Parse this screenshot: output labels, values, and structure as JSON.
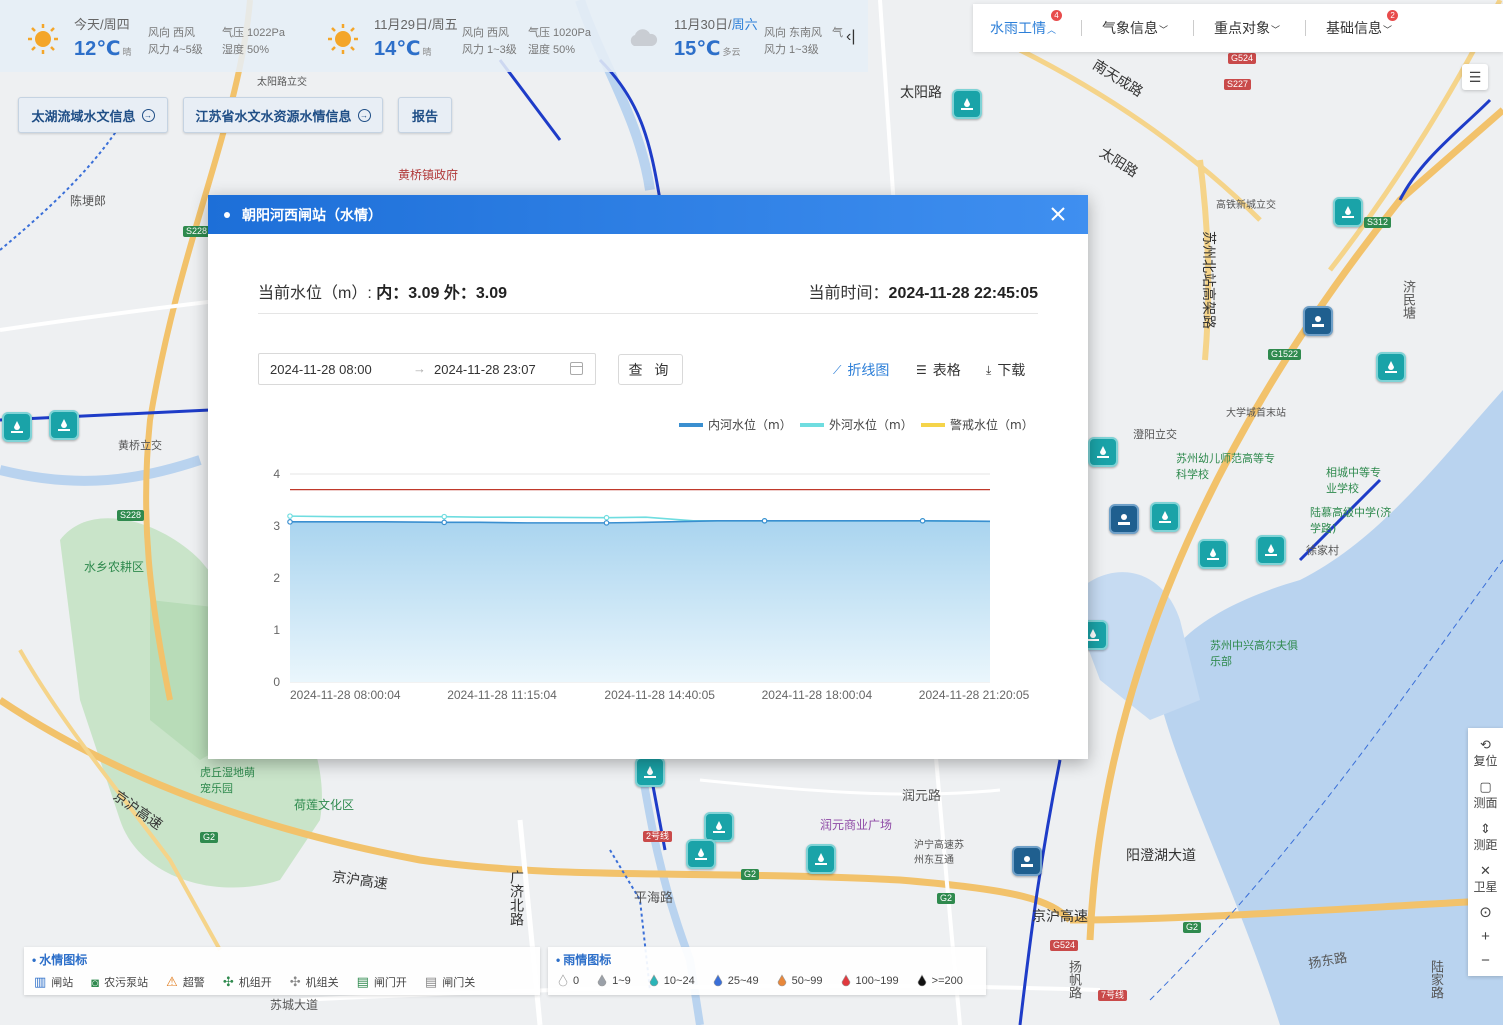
{
  "weather": [
    {
      "day": "今天/周四",
      "weekend": "",
      "temp": "12℃",
      "cond": "晴",
      "wind_dir": "风向 西风",
      "wind_force": "风力 4~5级",
      "pressure": "气压 1022Pa",
      "humidity": "湿度 50%",
      "icon": "sun-icon"
    },
    {
      "day": "11月29日/周五",
      "weekend": "",
      "temp": "14℃",
      "cond": "晴",
      "wind_dir": "风向 西风",
      "wind_force": "风力 1~3级",
      "pressure": "气压 1020Pa",
      "humidity": "湿度 50%",
      "icon": "sun-icon"
    },
    {
      "day": "11月30日/",
      "weekend": "周六",
      "temp": "15℃",
      "cond": "多云",
      "wind_dir": "风向 东南风",
      "wind_force": "风力 1~3级",
      "pressure": "气",
      "humidity": "",
      "icon": "cloud-icon"
    }
  ],
  "collapse_glyph": "‹|",
  "nav": [
    {
      "label": "水雨工情",
      "badge": "4",
      "active": true
    },
    {
      "label": "气象信息",
      "badge": "",
      "active": false
    },
    {
      "label": "重点对象",
      "badge": "",
      "active": false
    },
    {
      "label": "基础信息",
      "badge": "2",
      "active": false
    }
  ],
  "info_buttons": [
    {
      "label": "太湖流域水文信息",
      "arrow": "→"
    },
    {
      "label": "江苏省水文水资源水情信息",
      "arrow": "→"
    },
    {
      "label": "报告",
      "arrow": ""
    }
  ],
  "tools": [
    {
      "label": "复位",
      "icon": "reset-icon",
      "glyph": "⟲"
    },
    {
      "label": "测面",
      "icon": "area-icon",
      "glyph": "▢"
    },
    {
      "label": "测距",
      "icon": "distance-icon",
      "glyph": "⇕"
    },
    {
      "label": "卫星",
      "icon": "satellite-icon",
      "glyph": "✕"
    }
  ],
  "zoom": {
    "locate": "⊙",
    "plus": "+",
    "minus": "−"
  },
  "map_labels": [
    {
      "text": "太阳路",
      "cls": "big"
    },
    {
      "text": "南天成路",
      "cls": "big"
    },
    {
      "text": "太阳路",
      "cls": "big"
    },
    {
      "text": "高铁新城立交",
      "cls": ""
    },
    {
      "text": "苏州北站高架路",
      "cls": "big"
    },
    {
      "text": "济民塘",
      "cls": ""
    },
    {
      "text": "大学城首末站",
      "cls": ""
    },
    {
      "text": "澄阳立交",
      "cls": ""
    },
    {
      "text": "苏州幼儿师范高等专科学校",
      "cls": "green"
    },
    {
      "text": "相城中等专业学校",
      "cls": "green"
    },
    {
      "text": "陆慕高级中学(济学路)",
      "cls": "green"
    },
    {
      "text": "徐家村",
      "cls": ""
    },
    {
      "text": "苏州中兴高尔夫俱乐部",
      "cls": "green"
    },
    {
      "text": "阳澄湖大道",
      "cls": "big"
    },
    {
      "text": "京沪高速",
      "cls": "big"
    },
    {
      "text": "扬东路",
      "cls": ""
    },
    {
      "text": "陈埂郎",
      "cls": ""
    },
    {
      "text": "黄桥立交",
      "cls": ""
    },
    {
      "text": "水乡农耕区",
      "cls": "green"
    },
    {
      "text": "虎丘湿地萌宠乐园",
      "cls": "green"
    },
    {
      "text": "荷莲文化区",
      "cls": "green"
    },
    {
      "text": "京沪高速",
      "cls": "big"
    },
    {
      "text": "京沪高速",
      "cls": "big"
    },
    {
      "text": "平海路",
      "cls": ""
    },
    {
      "text": "广济北路",
      "cls": "big"
    },
    {
      "text": "润元路",
      "cls": ""
    },
    {
      "text": "润元商业广场",
      "cls": "purple"
    },
    {
      "text": "沪宁高速苏州东互通",
      "cls": ""
    },
    {
      "text": "黄桥镇政府",
      "cls": ""
    },
    {
      "text": "太阳路立交",
      "cls": ""
    },
    {
      "text": "苏城大道",
      "cls": ""
    },
    {
      "text": "扬帆路",
      "cls": ""
    },
    {
      "text": "陆家路",
      "cls": ""
    }
  ],
  "dialog": {
    "title": "朝阳河西闸站（水情）",
    "level_label": "当前水位（m）: ",
    "level_inner": "内：3.09",
    "level_outer": "外：3.09",
    "time_label": "当前时间：",
    "time_value": "2024-11-28 22:45:05",
    "range_start": "2024-11-28 08:00",
    "range_sep": "→",
    "range_end": "2024-11-28 23:07",
    "query": "查 询",
    "views": [
      {
        "label": "折线图",
        "icon": "line-chart-icon",
        "glyph": "⟋",
        "active": true
      },
      {
        "label": "表格",
        "icon": "table-icon",
        "glyph": "☰",
        "active": false
      },
      {
        "label": "下载",
        "icon": "download-icon",
        "glyph": "⤓",
        "active": false
      }
    ]
  },
  "chart_data": {
    "type": "line",
    "title": "",
    "xlabel": "",
    "ylabel": "",
    "ylim": [
      0,
      4
    ],
    "yticks": [
      0,
      1,
      2,
      3,
      4
    ],
    "xticks": [
      "2024-11-28 08:00:04",
      "2024-11-28 11:15:04",
      "2024-11-28 14:40:05",
      "2024-11-28 18:00:04",
      "2024-11-28 21:20:05"
    ],
    "grid": true,
    "legend_position": "top-right",
    "x_hours": [
      8.0,
      9.0,
      10.0,
      11.25,
      12.0,
      13.0,
      14.67,
      15.5,
      16.5,
      17.0,
      18.0,
      19.0,
      20.0,
      21.33,
      22.75
    ],
    "series": [
      {
        "name": "内河水位（m）",
        "color": "#3a8fd0",
        "values": [
          3.08,
          3.08,
          3.08,
          3.07,
          3.07,
          3.06,
          3.06,
          3.07,
          3.09,
          3.1,
          3.1,
          3.1,
          3.1,
          3.1,
          3.09
        ]
      },
      {
        "name": "外河水位（m）",
        "color": "#6fdde0",
        "values": [
          3.19,
          3.18,
          3.18,
          3.18,
          3.17,
          3.17,
          3.16,
          3.17,
          3.1,
          3.1,
          3.1,
          3.1,
          3.1,
          3.1,
          3.09
        ]
      },
      {
        "name": "警戒水位（m）",
        "color": "#f5d44a",
        "values": []
      }
    ],
    "warning_line": {
      "value": 3.7,
      "color": "#c0392b"
    }
  },
  "legends": {
    "water": {
      "title": "水情图标",
      "items": [
        {
          "label": "闸站",
          "icon": "gate-station-icon",
          "glyph": "▥",
          "color": "#2d6fc9"
        },
        {
          "label": "农污泵站",
          "icon": "pump-station-icon",
          "glyph": "◙",
          "color": "#2f8a4e"
        },
        {
          "label": "超警",
          "icon": "over-alert-icon",
          "glyph": "⚠",
          "color": "#e07a1a"
        },
        {
          "label": "机组开",
          "icon": "unit-on-icon",
          "glyph": "✣",
          "color": "#2f8a4e"
        },
        {
          "label": "机组关",
          "icon": "unit-off-icon",
          "glyph": "✣",
          "color": "#888888"
        },
        {
          "label": "闸门开",
          "icon": "gate-open-icon",
          "glyph": "▤",
          "color": "#2f8a4e"
        },
        {
          "label": "闸门关",
          "icon": "gate-closed-icon",
          "glyph": "▤",
          "color": "#888888"
        }
      ]
    },
    "rain": {
      "title": "雨情图标",
      "items": [
        {
          "label": "0",
          "color": "#ffffff"
        },
        {
          "label": "1~9",
          "color": "#9aa0a8"
        },
        {
          "label": "10~24",
          "color": "#2bb5b8"
        },
        {
          "label": "25~49",
          "color": "#3a6fd8"
        },
        {
          "label": "50~99",
          "color": "#e8873a"
        },
        {
          "label": "100~199",
          "color": "#e0393e"
        },
        {
          "label": ">=200",
          "color": "#111111"
        }
      ]
    }
  }
}
